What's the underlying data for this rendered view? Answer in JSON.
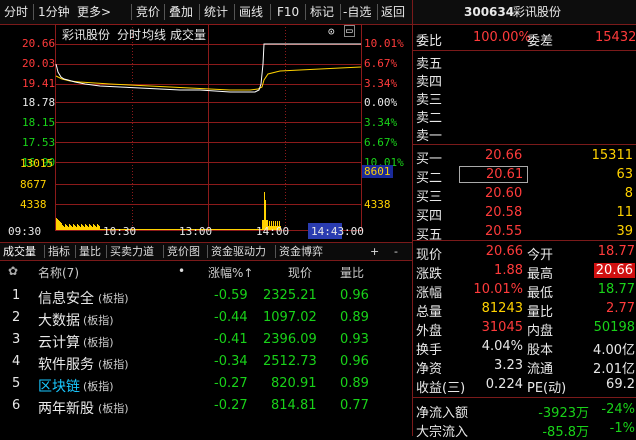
{
  "toolbar": {
    "items": [
      "分时",
      "1分钟",
      "更多>",
      "竞价",
      "叠加",
      "统计",
      "画线",
      "F10",
      "标记",
      "-自选",
      "返回"
    ],
    "stock_code": "300634",
    "stock_name": "彩讯股份"
  },
  "chart": {
    "title": "彩讯股份",
    "mode": "分时",
    "avg_label": "均线",
    "volume_label": "成交量",
    "price_labels_left": [
      "20.66",
      "20.03",
      "19.41",
      "18.78",
      "18.15",
      "17.53",
      "16.90"
    ],
    "pct_labels_right": [
      "10.01%",
      "6.67%",
      "3.34%",
      "0.00%",
      "3.34%",
      "6.67%",
      "10.01%"
    ],
    "vol_labels_left": [
      "13015",
      "8677",
      "4338"
    ],
    "vol_labels_right": [
      "13015",
      "8601",
      "4338"
    ],
    "time_labels": [
      "09:30",
      "10:30",
      "13:00",
      "14:00"
    ],
    "cursor_time": "14:43",
    "time_end": ":00",
    "colors": {
      "price_line": "#ffffff",
      "avg_line": "#ffd200",
      "grid": "#8b1a1a",
      "volume": "#ffd200"
    }
  },
  "tabs": [
    "成交量",
    "指标",
    "量比",
    "买卖力道",
    "竞价图",
    "资金驱动力",
    "资金博弈"
  ],
  "tabs_extra": [
    "+",
    "-"
  ],
  "sector_table": {
    "headers": {
      "name": "名称(7)",
      "change": "涨幅%↑",
      "price": "现价",
      "ratio": "量比"
    },
    "rows": [
      {
        "idx": "1",
        "name": "信息安全",
        "tag": "(板指)",
        "change": "-0.59",
        "price": "2325.21",
        "ratio": "0.96"
      },
      {
        "idx": "2",
        "name": "大数据",
        "tag": "(板指)",
        "change": "-0.44",
        "price": "1097.02",
        "ratio": "0.89"
      },
      {
        "idx": "3",
        "name": "云计算",
        "tag": "(板指)",
        "change": "-0.41",
        "price": "2396.09",
        "ratio": "0.93"
      },
      {
        "idx": "4",
        "name": "软件服务",
        "tag": "(板指)",
        "change": "-0.34",
        "price": "2512.73",
        "ratio": "0.96"
      },
      {
        "idx": "5",
        "name": "区块链",
        "tag": "(板指)",
        "change": "-0.27",
        "price": "820.91",
        "ratio": "0.89"
      },
      {
        "idx": "6",
        "name": "两年新股",
        "tag": "(板指)",
        "change": "-0.27",
        "price": "814.81",
        "ratio": "0.77"
      }
    ]
  },
  "order_book": {
    "weibi_label": "委比",
    "weibi": "100.00%",
    "weicha_label": "委差",
    "weicha": "15432",
    "sell": [
      "卖五",
      "卖四",
      "卖三",
      "卖二",
      "卖一"
    ],
    "buy": [
      {
        "label": "买一",
        "price": "20.66",
        "vol": "15311"
      },
      {
        "label": "买二",
        "price": "20.61",
        "vol": "63"
      },
      {
        "label": "买三",
        "price": "20.60",
        "vol": "8"
      },
      {
        "label": "买四",
        "price": "20.58",
        "vol": "11"
      },
      {
        "label": "买五",
        "price": "20.55",
        "vol": "39"
      }
    ]
  },
  "quote": [
    [
      {
        "l": "现价",
        "v": "20.66"
      },
      {
        "l": "今开",
        "v": "18.77"
      }
    ],
    [
      {
        "l": "涨跌",
        "v": "1.88"
      },
      {
        "l": "最高",
        "v": "20.66"
      }
    ],
    [
      {
        "l": "涨幅",
        "v": "10.01%"
      },
      {
        "l": "最低",
        "v": "18.77"
      }
    ],
    [
      {
        "l": "总量",
        "v": "81243"
      },
      {
        "l": "量比",
        "v": "2.77"
      }
    ],
    [
      {
        "l": "外盘",
        "v": "31045"
      },
      {
        "l": "内盘",
        "v": "50198"
      }
    ],
    [
      {
        "l": "换手",
        "v": "4.04%"
      },
      {
        "l": "股本",
        "v": "4.00亿"
      }
    ],
    [
      {
        "l": "净资",
        "v": "3.23"
      },
      {
        "l": "流通",
        "v": "2.01亿"
      }
    ],
    [
      {
        "l": "收益(三)",
        "v": "0.224"
      },
      {
        "l": "PE(动)",
        "v": "69.2"
      }
    ]
  ],
  "flow": [
    {
      "l": "净流入额",
      "v": "-3923万",
      "p": "-24%"
    },
    {
      "l": "大宗流入",
      "v": "-85.8万",
      "p": "-1%"
    }
  ]
}
